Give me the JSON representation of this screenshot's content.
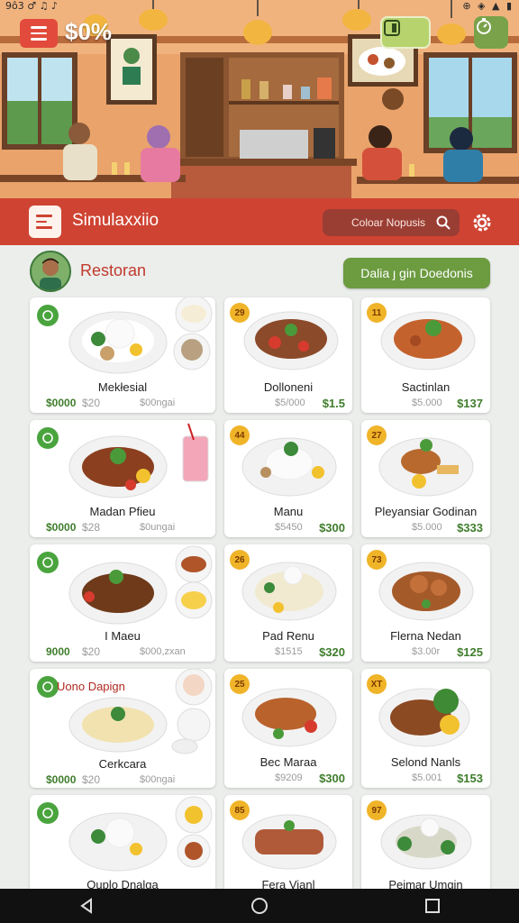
{
  "status_bar": {
    "left": "9ô3 ♂ ♫ ♪",
    "right": "⊕ ◈ ▲ ▮"
  },
  "header": {
    "promo_text": "$0%",
    "app_title": "Simulaxxiio",
    "search_placeholder": "Coloar Nopusis",
    "accent_color": "#cf4332",
    "menu_icon": "hamburger-icon",
    "settings_icon": "gear-icon"
  },
  "restaurant": {
    "title": "Restoran",
    "cta_label": "Dalia ȷ gin Doedonis",
    "cta_color": "#6c9b40"
  },
  "menu_items": [
    {
      "name": "Mekłesial",
      "price_main": "$0000",
      "price_alt": "$20",
      "price_note": "$00ngai",
      "badge": ""
    },
    {
      "name": "Dolloneni",
      "price_alt": "$5/000",
      "price": "$1.5",
      "badge": "29"
    },
    {
      "name": "Sactinlan",
      "price_alt": "$5.000",
      "price": "$137",
      "badge": "11"
    },
    {
      "name": "Madan Pfieu",
      "price_main": "$0000",
      "price_alt": "$28",
      "price_note": "$0ungai",
      "badge": ""
    },
    {
      "name": "Manu",
      "price_alt": "$5450",
      "price": "$300",
      "badge": "44"
    },
    {
      "name": "Pleyansiar Godinan",
      "price_alt": "$5.000",
      "price": "$333",
      "badge": "27"
    },
    {
      "name": "I Maeu",
      "price_main": "9000",
      "price_alt": "$20",
      "price_note": "$000,zxan",
      "badge": ""
    },
    {
      "name": "Pad Renu",
      "price_alt": "$1515",
      "price": "$320",
      "badge": "26"
    },
    {
      "name": "Flerna Nedan",
      "price_alt": "$3.00r",
      "price": "$125",
      "badge": "73"
    },
    {
      "name": "Cerkcara",
      "heading": "Uono Dapign",
      "price_main": "$0000",
      "price_alt": "$20",
      "price_note": "$00ngai",
      "badge": ""
    },
    {
      "name": "Bec Maraa",
      "price_alt": "$9209",
      "price": "$300",
      "badge": "25"
    },
    {
      "name": "Selond Nanls",
      "price_alt": "$5.001",
      "price": "$153",
      "badge": "XT"
    },
    {
      "name": "Ouplo Dnalga",
      "badge": ""
    },
    {
      "name": "Fera Vianl",
      "badge": "85"
    },
    {
      "name": "Peimar Umgin",
      "badge": "97"
    }
  ],
  "nav": {
    "back": "back-icon",
    "home": "home-icon",
    "recents": "recents-icon"
  }
}
